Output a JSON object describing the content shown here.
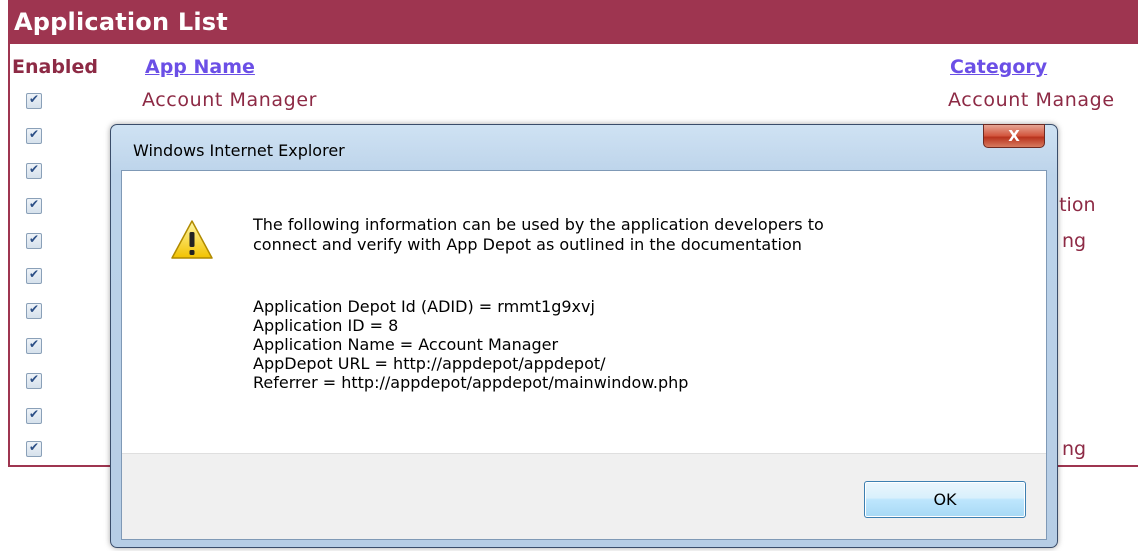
{
  "app_list": {
    "title": "Application List",
    "columns": {
      "enabled": "Enabled",
      "app_name": "App Name",
      "category": "Category"
    },
    "rows": [
      {
        "name": "Account Manager",
        "category": "Account Manage"
      }
    ],
    "category_fragments": [
      "tation",
      "ng",
      "ng"
    ]
  },
  "dialog": {
    "title": "Windows Internet Explorer",
    "close_label": "X",
    "message_line1": "The following information can be used by the application developers to",
    "message_line2": "connect and verify with App Depot as outlined in the documentation",
    "info": [
      "Application Depot Id (ADID) = rmmt1g9xvj",
      "Application ID = 8",
      "Application Name = Account Manager",
      "AppDepot URL = http://appdepot/appdepot/",
      "Referrer = http://appdepot/appdepot/mainwindow.php"
    ],
    "ok_label": "OK"
  }
}
